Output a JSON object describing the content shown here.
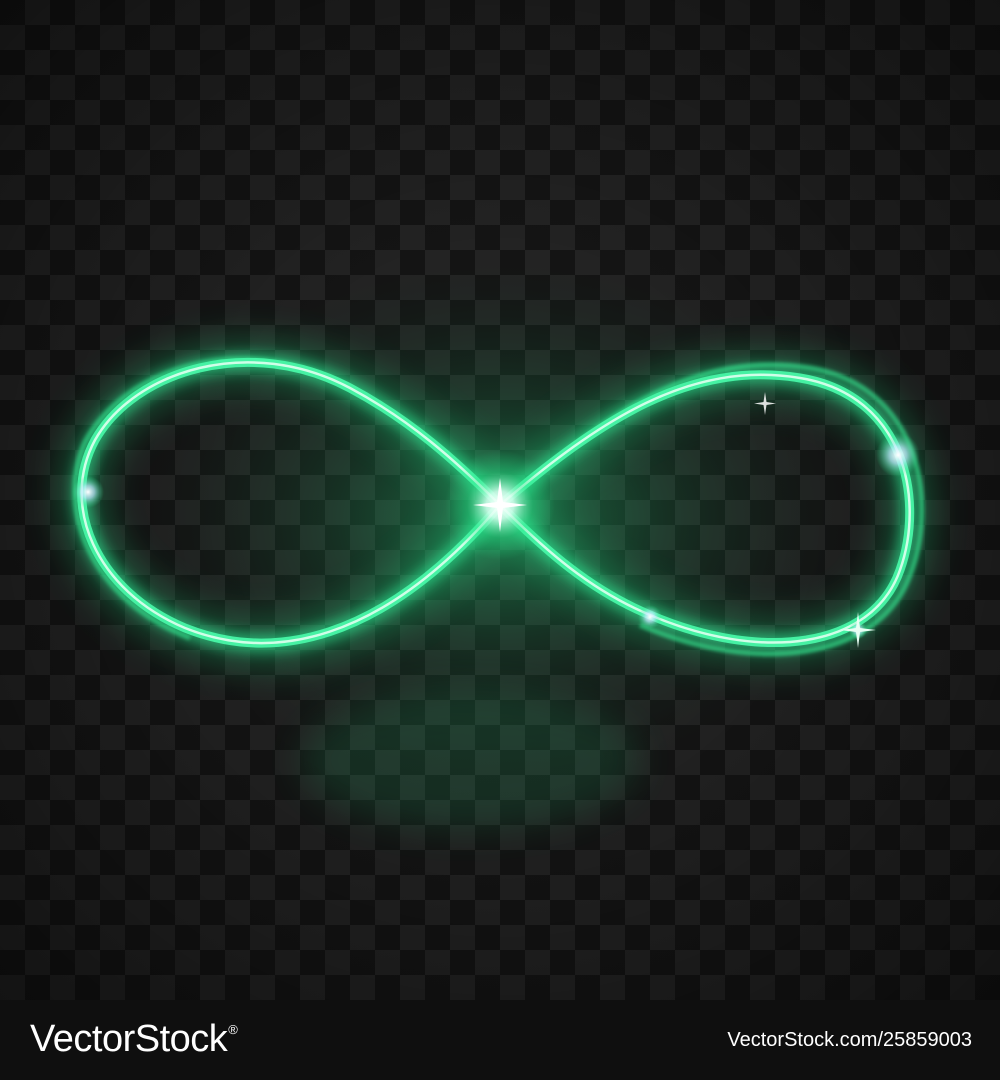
{
  "image": {
    "subject": "infinity-symbol",
    "glow_color": "#27e889",
    "highlight_color": "#d9fff0",
    "background": "transparency-checkerboard-dark"
  },
  "watermark": {
    "brand_name": "VectorStock",
    "trademark_symbol": "®",
    "image_id": "VectorStock.com/25859003"
  }
}
